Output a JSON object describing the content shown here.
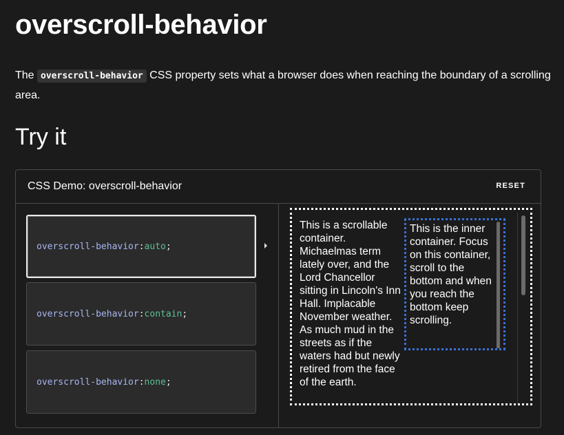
{
  "page": {
    "title": "overscroll-behavior",
    "intro_before": "The ",
    "intro_code": "overscroll-behavior",
    "intro_after": " CSS property sets what a browser does when reaching the boundary of a scrolling area.",
    "section_heading": "Try it"
  },
  "demo": {
    "title": "CSS Demo: overscroll-behavior",
    "reset_label": "RESET",
    "choices": [
      {
        "property": "overscroll-behavior",
        "colon": ": ",
        "value": "auto",
        "semicolon": ";",
        "selected": true
      },
      {
        "property": "overscroll-behavior",
        "colon": ": ",
        "value": "contain",
        "semicolon": ";",
        "selected": false
      },
      {
        "property": "overscroll-behavior",
        "colon": ": ",
        "value": "none",
        "semicolon": ";",
        "selected": false
      }
    ],
    "outer_text": "This is a scrollable container. Michaelmas term lately over, and the Lord Chancellor sitting in Lincoln's Inn Hall. Implacable November weather. As much mud in the streets as if the waters had but newly retired from the face of the earth.",
    "inner_text": "This is the inner container. Focus on this container, scroll to the bottom and when you reach the bottom keep scrolling."
  },
  "colors": {
    "background": "#1b1b1b",
    "code_property": "#a7b7f2",
    "code_value": "#5fbf93",
    "inner_border": "#3a72d8",
    "outer_border": "#ffffff"
  },
  "icons": {
    "selected_indicator": "caret-right-icon"
  }
}
